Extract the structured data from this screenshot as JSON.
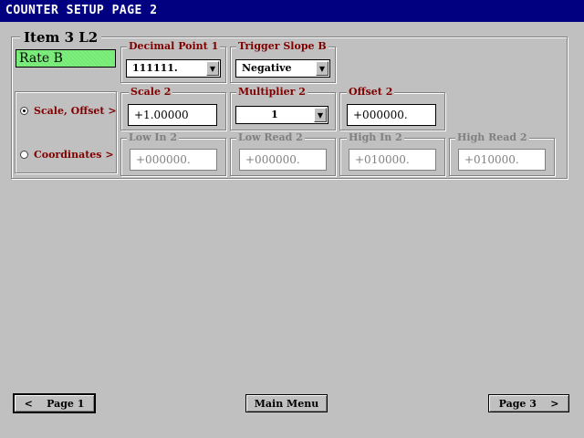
{
  "window": {
    "title": "COUNTER SETUP  PAGE  2"
  },
  "item": {
    "title": "Item 3  L2",
    "rate_label": "Rate B"
  },
  "decimal_point": {
    "label": "Decimal Point 1",
    "value": "111111."
  },
  "trigger_slope": {
    "label": "Trigger Slope B",
    "value": "Negative"
  },
  "mode": {
    "scale_offset": {
      "label": "Scale, Offset  >",
      "selected": true
    },
    "coordinates": {
      "label": "Coordinates  >",
      "selected": false
    }
  },
  "scale": {
    "label": "Scale 2",
    "value": "+1.00000"
  },
  "multiplier": {
    "label": "Multiplier 2",
    "value": "1"
  },
  "offset": {
    "label": "Offset 2",
    "value": "+000000."
  },
  "low_in": {
    "label": "Low In 2",
    "value": "+000000."
  },
  "low_read": {
    "label": "Low Read 2",
    "value": "+000000."
  },
  "high_in": {
    "label": "High In 2",
    "value": "+010000."
  },
  "high_read": {
    "label": "High Read 2",
    "value": "+010000."
  },
  "nav": {
    "prev_label": "<    Page 1",
    "main_label": "Main Menu",
    "next_label": "Page 3    >"
  },
  "colors": {
    "title_bar": "#000080",
    "label_red": "#800000",
    "rate_green": "#7cf07c",
    "background": "#c0c0c0"
  }
}
